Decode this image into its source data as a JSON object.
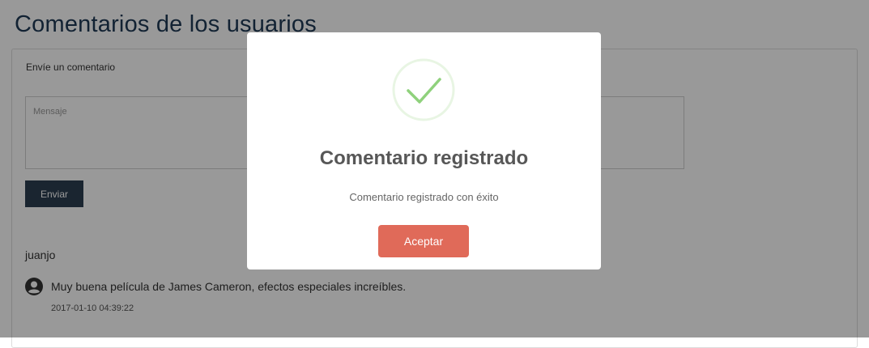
{
  "page": {
    "title": "Comentarios de los usuarios"
  },
  "form": {
    "label": "Envíe un comentario",
    "message_placeholder": "Mensaje",
    "send_label": "Enviar"
  },
  "comments": [
    {
      "author": "juanjo",
      "avatar_icon": "user-circle-icon",
      "text": "Muy buena película de James Cameron, efectos especiales increíbles.",
      "date": "2017-01-10 04:39:22"
    }
  ],
  "modal": {
    "icon": "success-check-icon",
    "title": "Comentario registrado",
    "text": "Comentario registrado con éxito",
    "accept_label": "Aceptar"
  },
  "colors": {
    "title": "#1e3a55",
    "send_button": "#2c3e50",
    "accept_button": "#e06a59",
    "success_icon": "#8fd17c",
    "overlay": "rgba(0,0,0,0.40)"
  }
}
